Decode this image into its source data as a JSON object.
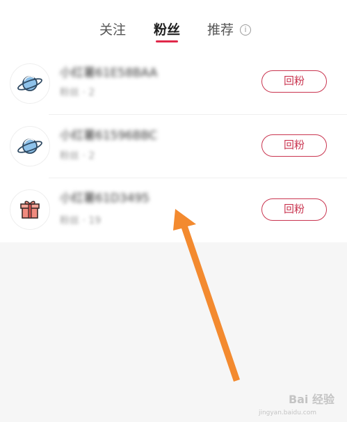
{
  "tabs": [
    {
      "label": "关注"
    },
    {
      "label": "粉丝"
    },
    {
      "label": "推荐"
    }
  ],
  "info_icon_glyph": "i",
  "fans": [
    {
      "name": "小红薯61E58BAA",
      "sub": "粉丝 · 2",
      "button": "回粉",
      "avatar": "planet-icon"
    },
    {
      "name": "小红薯61596BBC",
      "sub": "粉丝 · 2",
      "button": "回粉",
      "avatar": "planet-icon"
    },
    {
      "name": "小红薯61D3495",
      "sub": "粉丝 · 19",
      "button": "回粉",
      "avatar": "gift-icon"
    }
  ],
  "watermark": {
    "text": "Bai 经验",
    "sub": "jingyan.baidu.com"
  },
  "colors": {
    "accent": "#e0284a",
    "button": "#c9344f",
    "arrow": "#f38a2f"
  }
}
